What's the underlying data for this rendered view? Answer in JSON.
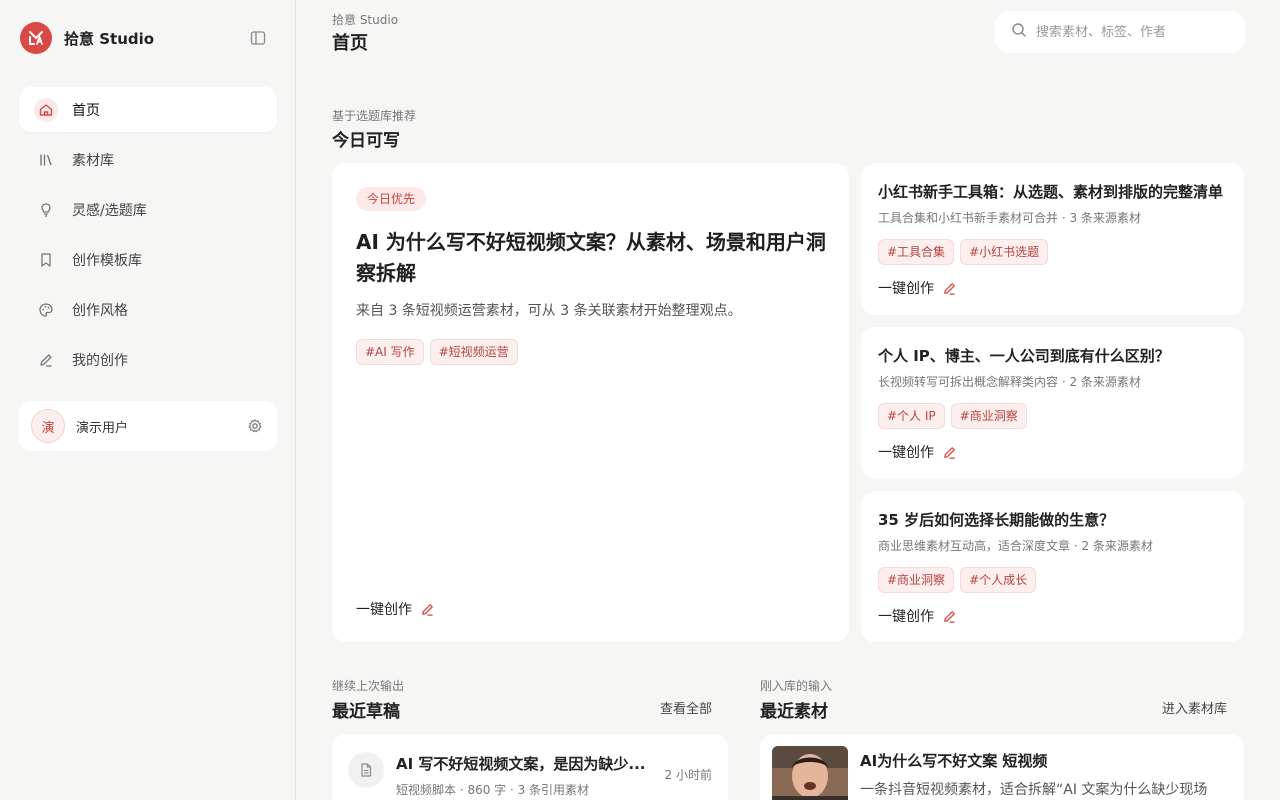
{
  "app": {
    "name": "拾意 Studio"
  },
  "sidebar": {
    "items": [
      {
        "label": "首页",
        "icon": "home-icon",
        "active": true
      },
      {
        "label": "素材库",
        "icon": "library-icon"
      },
      {
        "label": "灵感/选题库",
        "icon": "lightbulb-icon"
      },
      {
        "label": "创作模板库",
        "icon": "bookmark-icon"
      },
      {
        "label": "创作风格",
        "icon": "palette-icon"
      },
      {
        "label": "我的创作",
        "icon": "pencil-icon"
      }
    ],
    "user": {
      "avatar_text": "演",
      "name": "演示用户"
    }
  },
  "header": {
    "breadcrumb": "拾意 Studio",
    "title": "首页",
    "search_placeholder": "搜索素材、标签、作者"
  },
  "today": {
    "subtitle": "基于选题库推荐",
    "title": "今日可写",
    "featured": {
      "badge": "今日优先",
      "title": "AI 为什么写不好短视频文案？从素材、场景和用户洞察拆解",
      "desc": "来自 3 条短视频运营素材，可从 3 条关联素材开始整理观点。",
      "tags": [
        "#AI 写作",
        "#短视频运营"
      ],
      "action": "一键创作"
    },
    "cards": [
      {
        "title": "小红书新手工具箱：从选题、素材到排版的完整清单",
        "meta": "工具合集和小红书新手素材可合并 · 3 条来源素材",
        "tags": [
          "#工具合集",
          "#小红书选题"
        ],
        "action": "一键创作"
      },
      {
        "title": "个人 IP、博主、一人公司到底有什么区别？",
        "meta": "长视频转写可拆出概念解释类内容 · 2 条来源素材",
        "tags": [
          "#个人 IP",
          "#商业洞察"
        ],
        "action": "一键创作"
      },
      {
        "title": "35 岁后如何选择长期能做的生意？",
        "meta": "商业思维素材互动高，适合深度文章 · 2 条来源素材",
        "tags": [
          "#商业洞察",
          "#个人成长"
        ],
        "action": "一键创作"
      }
    ]
  },
  "drafts": {
    "subtitle": "继续上次输出",
    "title": "最近草稿",
    "link": "查看全部",
    "items": [
      {
        "title": "AI 写不好短视频文案，是因为缺少...",
        "meta": "短视频脚本 · 860 字 · 3 条引用素材",
        "time": "2 小时前"
      }
    ]
  },
  "materials": {
    "subtitle": "刚入库的输入",
    "title": "最近素材",
    "link": "进入素材库",
    "items": [
      {
        "title": "AI为什么写不好文案 短视频",
        "desc": "一条抖音短视频素材，适合拆解“AI 文案为什么缺少现场"
      }
    ]
  },
  "colors": {
    "accent": "#d94a46",
    "tag_bg": "#fcefee",
    "tag_text": "#b8433f",
    "page_bg": "#f6f6f5"
  }
}
